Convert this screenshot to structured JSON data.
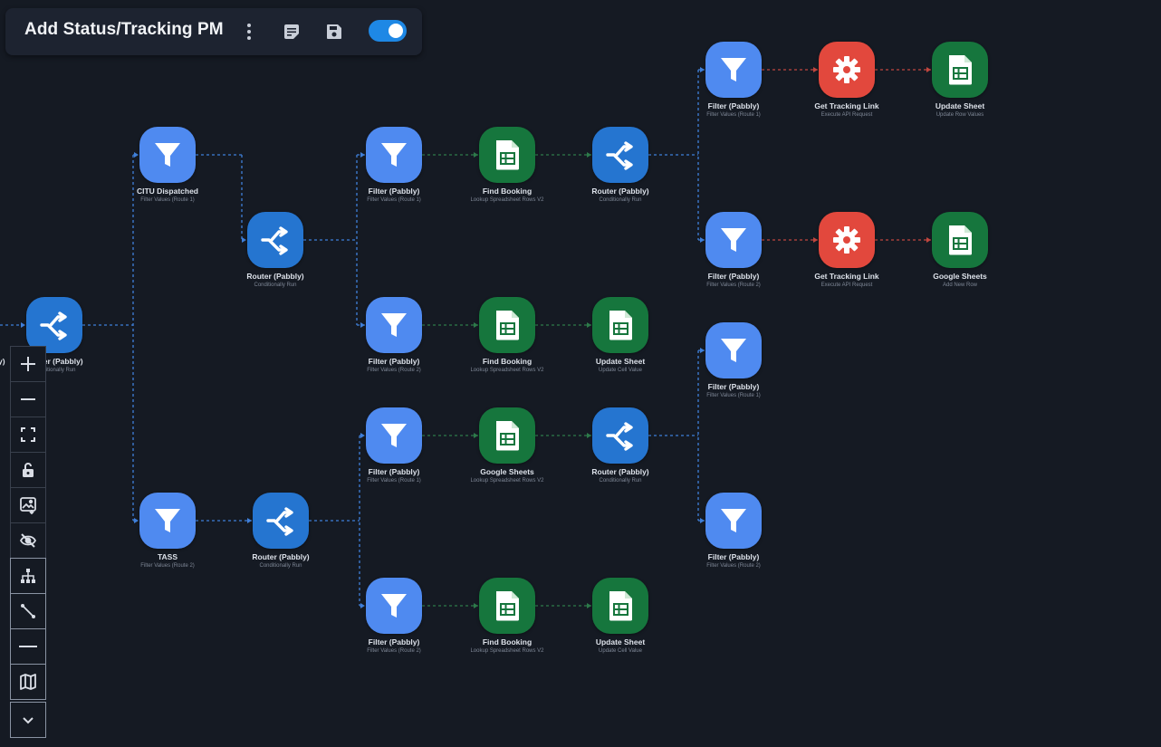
{
  "header": {
    "title": "Add Status/Tracking PM",
    "toggle_on": true
  },
  "edge_label_fragment": "y)",
  "nodes": [
    {
      "type": "router",
      "title": "Router (Pabbly)",
      "subtitle": "Conditionally Run",
      "icon": "router-icon"
    },
    {
      "type": "filter",
      "title": "CITU Dispatched",
      "subtitle": "Filter Values (Route 1)",
      "icon": "filter-icon"
    },
    {
      "type": "filter",
      "title": "TASS",
      "subtitle": "Filter Values (Route 2)",
      "icon": "filter-icon"
    },
    {
      "type": "router",
      "title": "Router (Pabbly)",
      "subtitle": "Conditionally Run",
      "icon": "router-icon"
    },
    {
      "type": "router",
      "title": "Router (Pabbly)",
      "subtitle": "Conditionally Run",
      "icon": "router-icon"
    },
    {
      "type": "filter",
      "title": "Filter (Pabbly)",
      "subtitle": "Filter Values (Route 1)",
      "icon": "filter-icon"
    },
    {
      "type": "sheets",
      "title": "Find Booking",
      "subtitle": "Lookup Spreadsheet Rows V2",
      "icon": "spreadsheet-icon"
    },
    {
      "type": "router",
      "title": "Router (Pabbly)",
      "subtitle": "Conditionally Run",
      "icon": "router-icon"
    },
    {
      "type": "filter",
      "title": "Filter (Pabbly)",
      "subtitle": "Filter Values (Route 2)",
      "icon": "filter-icon"
    },
    {
      "type": "sheets",
      "title": "Find Booking",
      "subtitle": "Lookup Spreadsheet Rows V2",
      "icon": "spreadsheet-icon"
    },
    {
      "type": "sheets",
      "title": "Update Sheet",
      "subtitle": "Update Cell Value",
      "icon": "spreadsheet-icon"
    },
    {
      "type": "filter",
      "title": "Filter (Pabbly)",
      "subtitle": "Filter Values (Route 1)",
      "icon": "filter-icon"
    },
    {
      "type": "sheets",
      "title": "Google Sheets",
      "subtitle": "Lookup Spreadsheet Rows V2",
      "icon": "spreadsheet-icon"
    },
    {
      "type": "router",
      "title": "Router (Pabbly)",
      "subtitle": "Conditionally Run",
      "icon": "router-icon"
    },
    {
      "type": "filter",
      "title": "Filter (Pabbly)",
      "subtitle": "Filter Values (Route 2)",
      "icon": "filter-icon"
    },
    {
      "type": "sheets",
      "title": "Find Booking",
      "subtitle": "Lookup Spreadsheet Rows V2",
      "icon": "spreadsheet-icon"
    },
    {
      "type": "sheets",
      "title": "Update Sheet",
      "subtitle": "Update Cell Value",
      "icon": "spreadsheet-icon"
    },
    {
      "type": "filter",
      "title": "Filter (Pabbly)",
      "subtitle": "Filter Values (Route 1)",
      "icon": "filter-icon"
    },
    {
      "type": "api",
      "title": "Get Tracking Link",
      "subtitle": "Execute API Request",
      "icon": "gear-icon"
    },
    {
      "type": "sheets",
      "title": "Update Sheet",
      "subtitle": "Update Row Values",
      "icon": "spreadsheet-icon"
    },
    {
      "type": "filter",
      "title": "Filter (Pabbly)",
      "subtitle": "Filter Values (Route 2)",
      "icon": "filter-icon"
    },
    {
      "type": "api",
      "title": "Get Tracking Link",
      "subtitle": "Execute API Request",
      "icon": "gear-icon"
    },
    {
      "type": "sheets",
      "title": "Google Sheets",
      "subtitle": "Add New Row",
      "icon": "spreadsheet-icon"
    },
    {
      "type": "filter",
      "title": "Filter (Pabbly)",
      "subtitle": "Filter Values (Route 1)",
      "icon": "filter-icon"
    },
    {
      "type": "filter",
      "title": "Filter (Pabbly)",
      "subtitle": "Filter Values (Route 2)",
      "icon": "filter-icon"
    }
  ],
  "toolbar": [
    {
      "name": "zoom-in",
      "icon": "plus-icon"
    },
    {
      "name": "zoom-out",
      "icon": "minus-icon"
    },
    {
      "name": "fit-view",
      "icon": "fit-screen-icon"
    },
    {
      "name": "lock",
      "icon": "unlock-icon"
    },
    {
      "name": "download-image",
      "icon": "image-download-icon"
    },
    {
      "name": "hide",
      "icon": "eye-off-icon"
    },
    {
      "name": "layout-tree",
      "icon": "tree-layout-icon"
    },
    {
      "name": "edge-style",
      "icon": "diagonal-edge-icon"
    },
    {
      "name": "edge-straight",
      "icon": "straight-edge-icon"
    },
    {
      "name": "minimap",
      "icon": "map-icon"
    },
    {
      "name": "more",
      "icon": "chevron-down-icon"
    }
  ],
  "colors": {
    "background": "#151a23",
    "filter": "#4f8af0",
    "router": "#2575d0",
    "sheets": "#16763d",
    "api": "#e2483d",
    "edge_blue": "#3f7fd9",
    "edge_green": "#2d7a4a",
    "edge_red": "#c0463e"
  }
}
